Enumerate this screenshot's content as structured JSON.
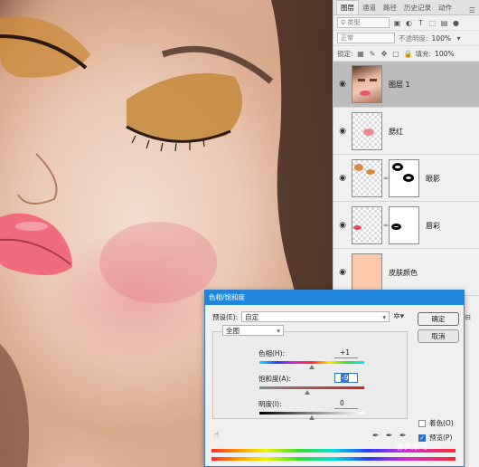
{
  "colors": {
    "dialog_title": "#1f86de",
    "active_layer": "#bcbcbc",
    "skin_swatch": "#fcc8aa"
  },
  "image": {
    "subject": "close-up of a woman's face with gold eyeshadow and pink blush"
  },
  "layers_panel": {
    "tabs": [
      "图层",
      "通道",
      "路径",
      "历史记录",
      "动作"
    ],
    "filter_kind": "类型",
    "blend_mode": "正常",
    "opacity_label": "不透明度:",
    "opacity_value": "100%",
    "lock_label": "锁定:",
    "fill_label": "填充:",
    "fill_value": "100%",
    "layers": [
      {
        "name": "图层 1",
        "active": true,
        "has_mask": false
      },
      {
        "name": "腮红",
        "active": false,
        "has_mask": false
      },
      {
        "name": "眼影",
        "active": false,
        "has_mask": true
      },
      {
        "name": "唇彩",
        "active": false,
        "has_mask": true
      },
      {
        "name": "皮肤颜色",
        "active": false,
        "has_mask": false
      }
    ]
  },
  "dialog": {
    "title": "色相/饱和度",
    "preset_label": "预设(E):",
    "preset_value": "自定",
    "ok_label": "确定",
    "cancel_label": "取消",
    "channel": "全图",
    "hue_label": "色相(H):",
    "hue_value": "+1",
    "hue_pos": 0.5,
    "sat_label": "饱和度(A):",
    "sat_value": "-9",
    "sat_pos": 0.46,
    "light_label": "明度(I):",
    "light_value": "0",
    "light_pos": 0.5,
    "colorize_label": "着色(O)",
    "colorize_checked": false,
    "preview_label": "预览(P)",
    "preview_checked": true
  },
  "watermark": "@头条号"
}
